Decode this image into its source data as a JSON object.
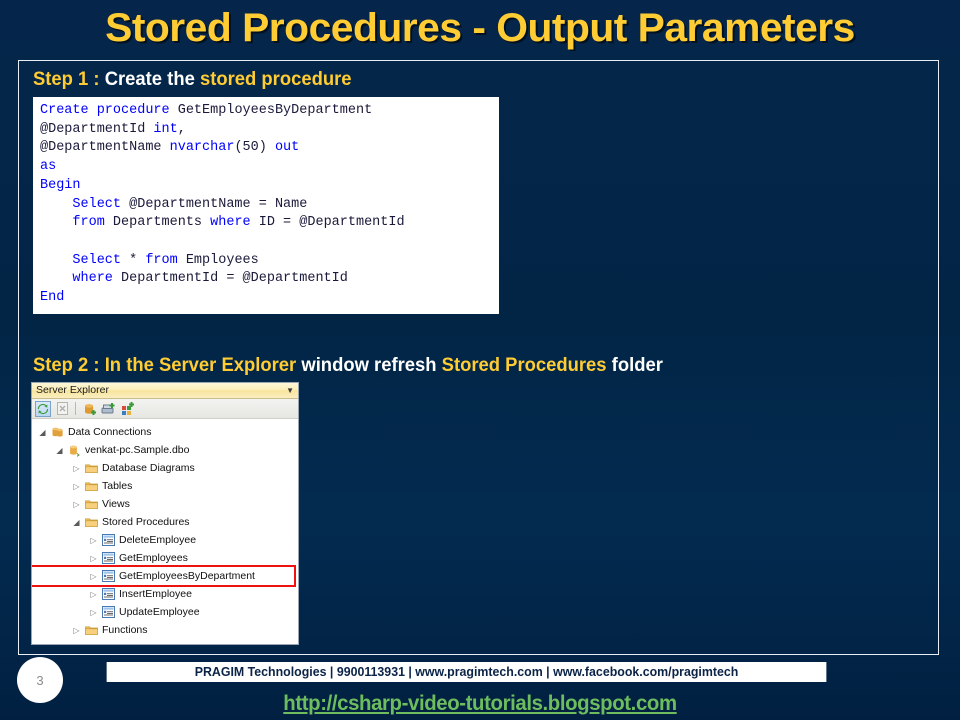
{
  "slide": {
    "title": "Stored Procedures - Output Parameters",
    "background_color": "#022546",
    "title_color": "#ffcc33",
    "number": "3"
  },
  "step1": {
    "prefix": "Step 1 : ",
    "middle": "Create the ",
    "suffix": "stored procedure"
  },
  "step2": {
    "prefix": "Step 2 : ",
    "p1": "In the Server Explorer",
    "p2": " window refresh ",
    "p3": "Stored Procedures",
    "p4": " folder"
  },
  "code": {
    "language": "sql",
    "keyword_color": "#0000ff",
    "text_color": "#1a1a3a",
    "lines": [
      [
        {
          "t": "Create procedure ",
          "k": true
        },
        {
          "t": "GetEmployeesByDepartment",
          "k": false
        }
      ],
      [
        {
          "t": "@DepartmentId ",
          "k": false
        },
        {
          "t": "int",
          "k": true
        },
        {
          "t": ",",
          "k": false
        }
      ],
      [
        {
          "t": "@DepartmentName ",
          "k": false
        },
        {
          "t": "nvarchar",
          "k": true
        },
        {
          "t": "(50) ",
          "k": false
        },
        {
          "t": "out",
          "k": true
        }
      ],
      [
        {
          "t": "as",
          "k": true
        }
      ],
      [
        {
          "t": "Begin",
          "k": true
        }
      ],
      [
        {
          "t": "    ",
          "k": false
        },
        {
          "t": "Select",
          "k": true
        },
        {
          "t": " @DepartmentName = Name",
          "k": false
        }
      ],
      [
        {
          "t": "    ",
          "k": false
        },
        {
          "t": "from",
          "k": true
        },
        {
          "t": " Departments ",
          "k": false
        },
        {
          "t": "where",
          "k": true
        },
        {
          "t": " ID = @DepartmentId",
          "k": false
        }
      ],
      [
        {
          "t": "",
          "k": false
        }
      ],
      [
        {
          "t": "    ",
          "k": false
        },
        {
          "t": "Select",
          "k": true
        },
        {
          "t": " * ",
          "k": false
        },
        {
          "t": "from",
          "k": true
        },
        {
          "t": " Employees",
          "k": false
        }
      ],
      [
        {
          "t": "    ",
          "k": false
        },
        {
          "t": "where",
          "k": true
        },
        {
          "t": " DepartmentId = @DepartmentId",
          "k": false
        }
      ],
      [
        {
          "t": "End",
          "k": true
        }
      ]
    ]
  },
  "server_explorer": {
    "title": "Server Explorer",
    "toolbar": [
      {
        "name": "refresh-icon",
        "active": true
      },
      {
        "name": "stop-icon",
        "active": false
      },
      {
        "name": "separator",
        "active": false
      },
      {
        "name": "connect-to-database-icon",
        "active": false
      },
      {
        "name": "connect-to-server-icon",
        "active": false
      },
      {
        "name": "add-server-icon",
        "active": false
      }
    ],
    "tree": [
      {
        "label": "Data Connections",
        "indent": 0,
        "arrow": "open",
        "icon": "data-connections-icon"
      },
      {
        "label": "venkat-pc.Sample.dbo",
        "indent": 1,
        "arrow": "open",
        "icon": "database-icon"
      },
      {
        "label": "Database Diagrams",
        "indent": 2,
        "arrow": "closed",
        "icon": "folder-icon"
      },
      {
        "label": "Tables",
        "indent": 2,
        "arrow": "closed",
        "icon": "folder-icon"
      },
      {
        "label": "Views",
        "indent": 2,
        "arrow": "closed",
        "icon": "folder-icon"
      },
      {
        "label": "Stored Procedures",
        "indent": 2,
        "arrow": "open",
        "icon": "folder-icon"
      },
      {
        "label": "DeleteEmployee",
        "indent": 3,
        "arrow": "closed",
        "icon": "stored-procedure-icon"
      },
      {
        "label": "GetEmployees",
        "indent": 3,
        "arrow": "closed",
        "icon": "stored-procedure-icon"
      },
      {
        "label": "GetEmployeesByDepartment",
        "indent": 3,
        "arrow": "closed",
        "icon": "stored-procedure-icon",
        "highlight": true
      },
      {
        "label": "InsertEmployee",
        "indent": 3,
        "arrow": "closed",
        "icon": "stored-procedure-icon"
      },
      {
        "label": "UpdateEmployee",
        "indent": 3,
        "arrow": "closed",
        "icon": "stored-procedure-icon"
      },
      {
        "label": "Functions",
        "indent": 2,
        "arrow": "closed",
        "icon": "folder-icon"
      }
    ],
    "highlight_color": "#ee1111"
  },
  "footer": {
    "credits": "PRAGIM Technologies | 9900113931 | www.pragimtech.com | www.facebook.com/pragimtech",
    "url": "http://csharp-video-tutorials.blogspot.com",
    "url_color": "#6dbd5e"
  }
}
